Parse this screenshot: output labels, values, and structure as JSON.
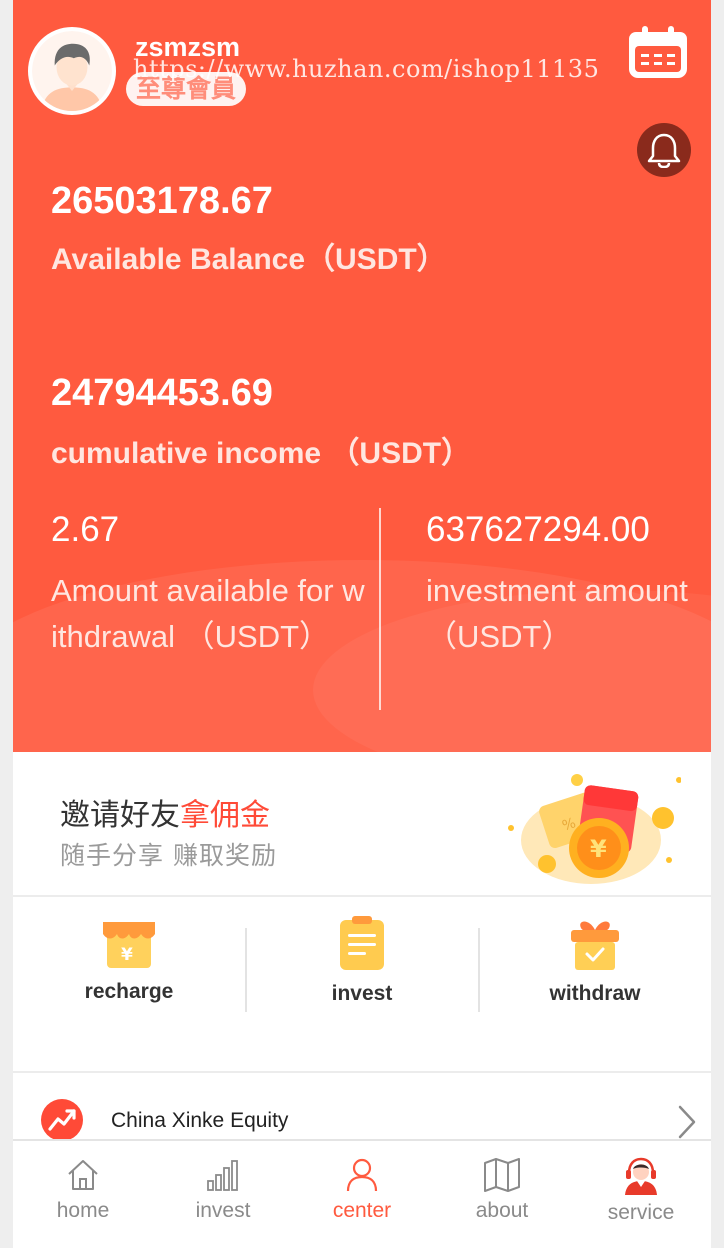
{
  "user": {
    "name": "zsmzsm",
    "badge": "至尊會員",
    "watermark": "https://www.huzhan.com/ishop11135"
  },
  "balance": {
    "available_value": "26503178.67",
    "available_label": "Available Balance（USDT）",
    "cumulative_value": "24794453.69",
    "cumulative_label": "cumulative income （USDT）"
  },
  "stats": {
    "withdrawable_value": "2.67",
    "withdrawable_label": "Amount available for withdrawal （USDT）",
    "investment_value": "637627294.00",
    "investment_label": "investment amount （USDT）"
  },
  "invite": {
    "title_plain": "邀请好友",
    "title_highlight": "拿佣金",
    "subtitle": "随手分享 赚取奖励"
  },
  "actions": [
    {
      "label": "recharge",
      "icon": "shop-icon"
    },
    {
      "label": "invest",
      "icon": "document-icon"
    },
    {
      "label": "withdraw",
      "icon": "gift-icon"
    }
  ],
  "list": [
    {
      "label": "China Xinke Equity",
      "icon": "trend-chart-icon"
    }
  ],
  "nav": [
    {
      "label": "home",
      "icon": "home-icon"
    },
    {
      "label": "invest",
      "icon": "bar-chart-icon"
    },
    {
      "label": "center",
      "icon": "user-icon"
    },
    {
      "label": "about",
      "icon": "map-icon"
    },
    {
      "label": "service",
      "icon": "customer-service-icon"
    }
  ],
  "colors": {
    "brand": "#ff5a3f",
    "accent_text": "#ff4a37",
    "icon_gold": "#ffc94a"
  }
}
